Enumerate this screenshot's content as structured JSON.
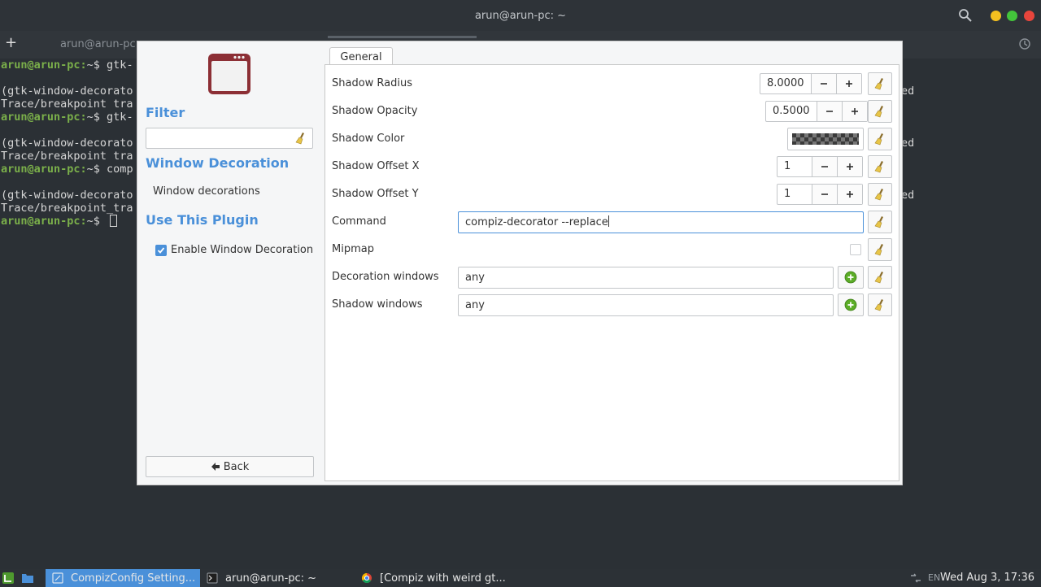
{
  "colors": {
    "accent": "#4a90d9",
    "prompt_green": "#7bb04a",
    "terminal_bg": "#2b3035",
    "dialog_bg": "#f5f6f7",
    "add_green": "#5cad27"
  },
  "terminal": {
    "title": "arun@arun-pc: ~",
    "tab_label": "arun@arun-pc:",
    "lines": [
      {
        "prompt": "arun@arun-pc:",
        "text": "~$ gtk-"
      },
      {
        "prompt": "",
        "text": ""
      },
      {
        "prompt": "",
        "text": "(gtk-window-decorato"
      },
      {
        "prompt": "",
        "text": "Trace/breakpoint tra"
      },
      {
        "prompt": "arun@arun-pc:",
        "text": "~$ gtk-"
      },
      {
        "prompt": "",
        "text": ""
      },
      {
        "prompt": "",
        "text": "(gtk-window-decorato"
      },
      {
        "prompt": "",
        "text": "Trace/breakpoint tra"
      },
      {
        "prompt": "arun@arun-pc:",
        "text": "~$ comp"
      },
      {
        "prompt": "",
        "text": ""
      },
      {
        "prompt": "",
        "text": "(gtk-window-decorato"
      },
      {
        "prompt": "",
        "text": "Trace/breakpoint_tra"
      },
      {
        "prompt": "arun@arun-pc:",
        "text": "~$ "
      }
    ],
    "right_fragments": [
      "ed",
      "ed",
      "ed"
    ]
  },
  "sidebar": {
    "filter_heading": "Filter",
    "filter_value": "",
    "section_heading": "Window Decoration",
    "section_item": "Window decorations",
    "plugin_heading": "Use This Plugin",
    "enable_label": "Enable Window Decoration",
    "enable_checked": true,
    "back_label": "Back"
  },
  "notebook": {
    "tab_label": "General"
  },
  "settings": {
    "shadow_radius": {
      "label": "Shadow Radius",
      "value": "8.0000"
    },
    "shadow_opacity": {
      "label": "Shadow Opacity",
      "value": "0.5000"
    },
    "shadow_color": {
      "label": "Shadow Color"
    },
    "shadow_offset_x": {
      "label": "Shadow Offset X",
      "value": "1"
    },
    "shadow_offset_y": {
      "label": "Shadow Offset Y",
      "value": "1"
    },
    "command": {
      "label": "Command",
      "value": "compiz-decorator --replace"
    },
    "mipmap": {
      "label": "Mipmap",
      "checked": false
    },
    "decoration_windows": {
      "label": "Decoration windows",
      "value": "any"
    },
    "shadow_windows": {
      "label": "Shadow windows",
      "value": "any"
    }
  },
  "taskbar": {
    "tasks": [
      {
        "label": "CompizConfig Setting...",
        "icon": "compiz-icon",
        "active": true
      },
      {
        "label": "arun@arun-pc: ~",
        "icon": "terminal-icon",
        "active": false
      },
      {
        "label": "[Compiz with weird gt...",
        "icon": "chrome-icon",
        "active": false
      }
    ],
    "keyboard_layout": "EN",
    "clock": "Wed Aug  3, 17:36"
  }
}
